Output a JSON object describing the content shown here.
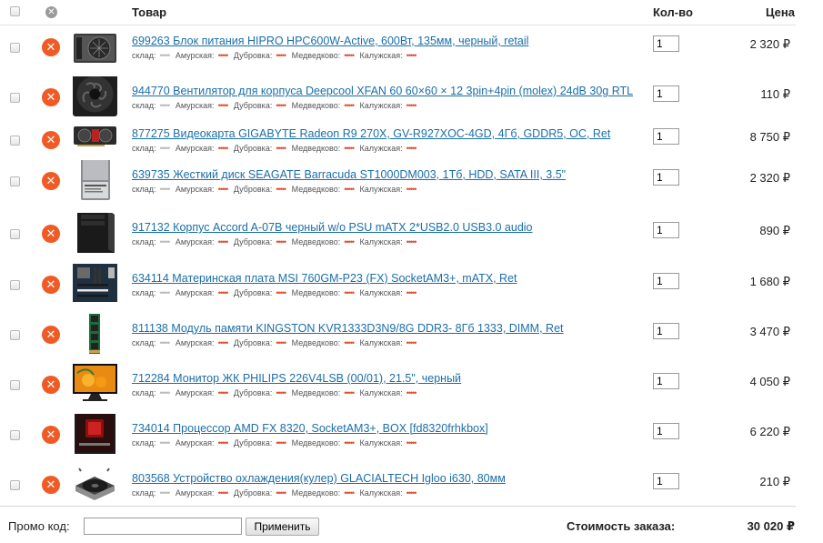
{
  "header": {
    "name_label": "Товар",
    "qty_label": "Кол-во",
    "price_label": "Цена"
  },
  "stock_labels": {
    "sklad": "склад:",
    "amurskaya": "Амурская:",
    "dubrovka": "Дубровка:",
    "medvedkovo": "Медведково:",
    "kaluzhskaya": "Калужская:"
  },
  "items": [
    {
      "title": "699263 Блок питания HIPRO HPC600W-Active, 600Вт, 135мм, черный, retail",
      "qty": "1",
      "price": "2 320 ₽",
      "icon": "psu-icon"
    },
    {
      "title": "944770 Вентилятор для корпуса Deepcool XFAN 60 60×60 × 12 3pin+4pin (molex) 24dB 30g RTL",
      "qty": "1",
      "price": "110 ₽",
      "icon": "fan-icon"
    },
    {
      "title": "877275 Видеокарта GIGABYTE Radeon R9 270X, GV-R927XOC-4GD, 4Гб, GDDR5, OC, Ret",
      "qty": "1",
      "price": "8 750 ₽",
      "icon": "gpu-icon"
    },
    {
      "title": "639735 Жесткий диск SEAGATE Barracuda ST1000DM003, 1Тб, HDD, SATA III, 3.5\"",
      "qty": "1",
      "price": "2 320 ₽",
      "icon": "hdd-icon"
    },
    {
      "title": "917132 Корпус Accord A-07B черный w/o PSU mATX 2*USB2.0 USB3.0 audio",
      "qty": "1",
      "price": "890 ₽",
      "icon": "case-icon"
    },
    {
      "title": "634114 Материнская плата MSI 760GM-P23 (FX) SocketAM3+, mATX, Ret",
      "qty": "1",
      "price": "1 680 ₽",
      "icon": "motherboard-icon"
    },
    {
      "title": "811138 Модуль памяти KINGSTON KVR1333D3N9/8G DDR3- 8Гб 1333, DIMM, Ret",
      "qty": "1",
      "price": "3 470 ₽",
      "icon": "ram-icon"
    },
    {
      "title": "712284 Монитор ЖК PHILIPS 226V4LSB (00/01), 21.5\", черный",
      "qty": "1",
      "price": "4 050 ₽",
      "icon": "monitor-icon"
    },
    {
      "title": "734014 Процессор AMD FX 8320, SocketAM3+, BOX [fd8320frhkbox]",
      "qty": "1",
      "price": "6 220 ₽",
      "icon": "cpu-box-icon"
    },
    {
      "title": "803568 Устройство охлаждения(кулер) GLACIALTECH Igloo i630, 80мм",
      "qty": "1",
      "price": "210 ₽",
      "icon": "cooler-icon"
    }
  ],
  "footer": {
    "promo_label": "Промо код:",
    "promo_value": "",
    "apply_label": "Применить",
    "total_label": "Стоимость заказа:",
    "total_value": "30 020 ₽"
  },
  "colors": {
    "link": "#1b6ea8",
    "remove": "#f05a24",
    "stock_ok": "#e05030",
    "stock_none": "#bbbbbb"
  }
}
